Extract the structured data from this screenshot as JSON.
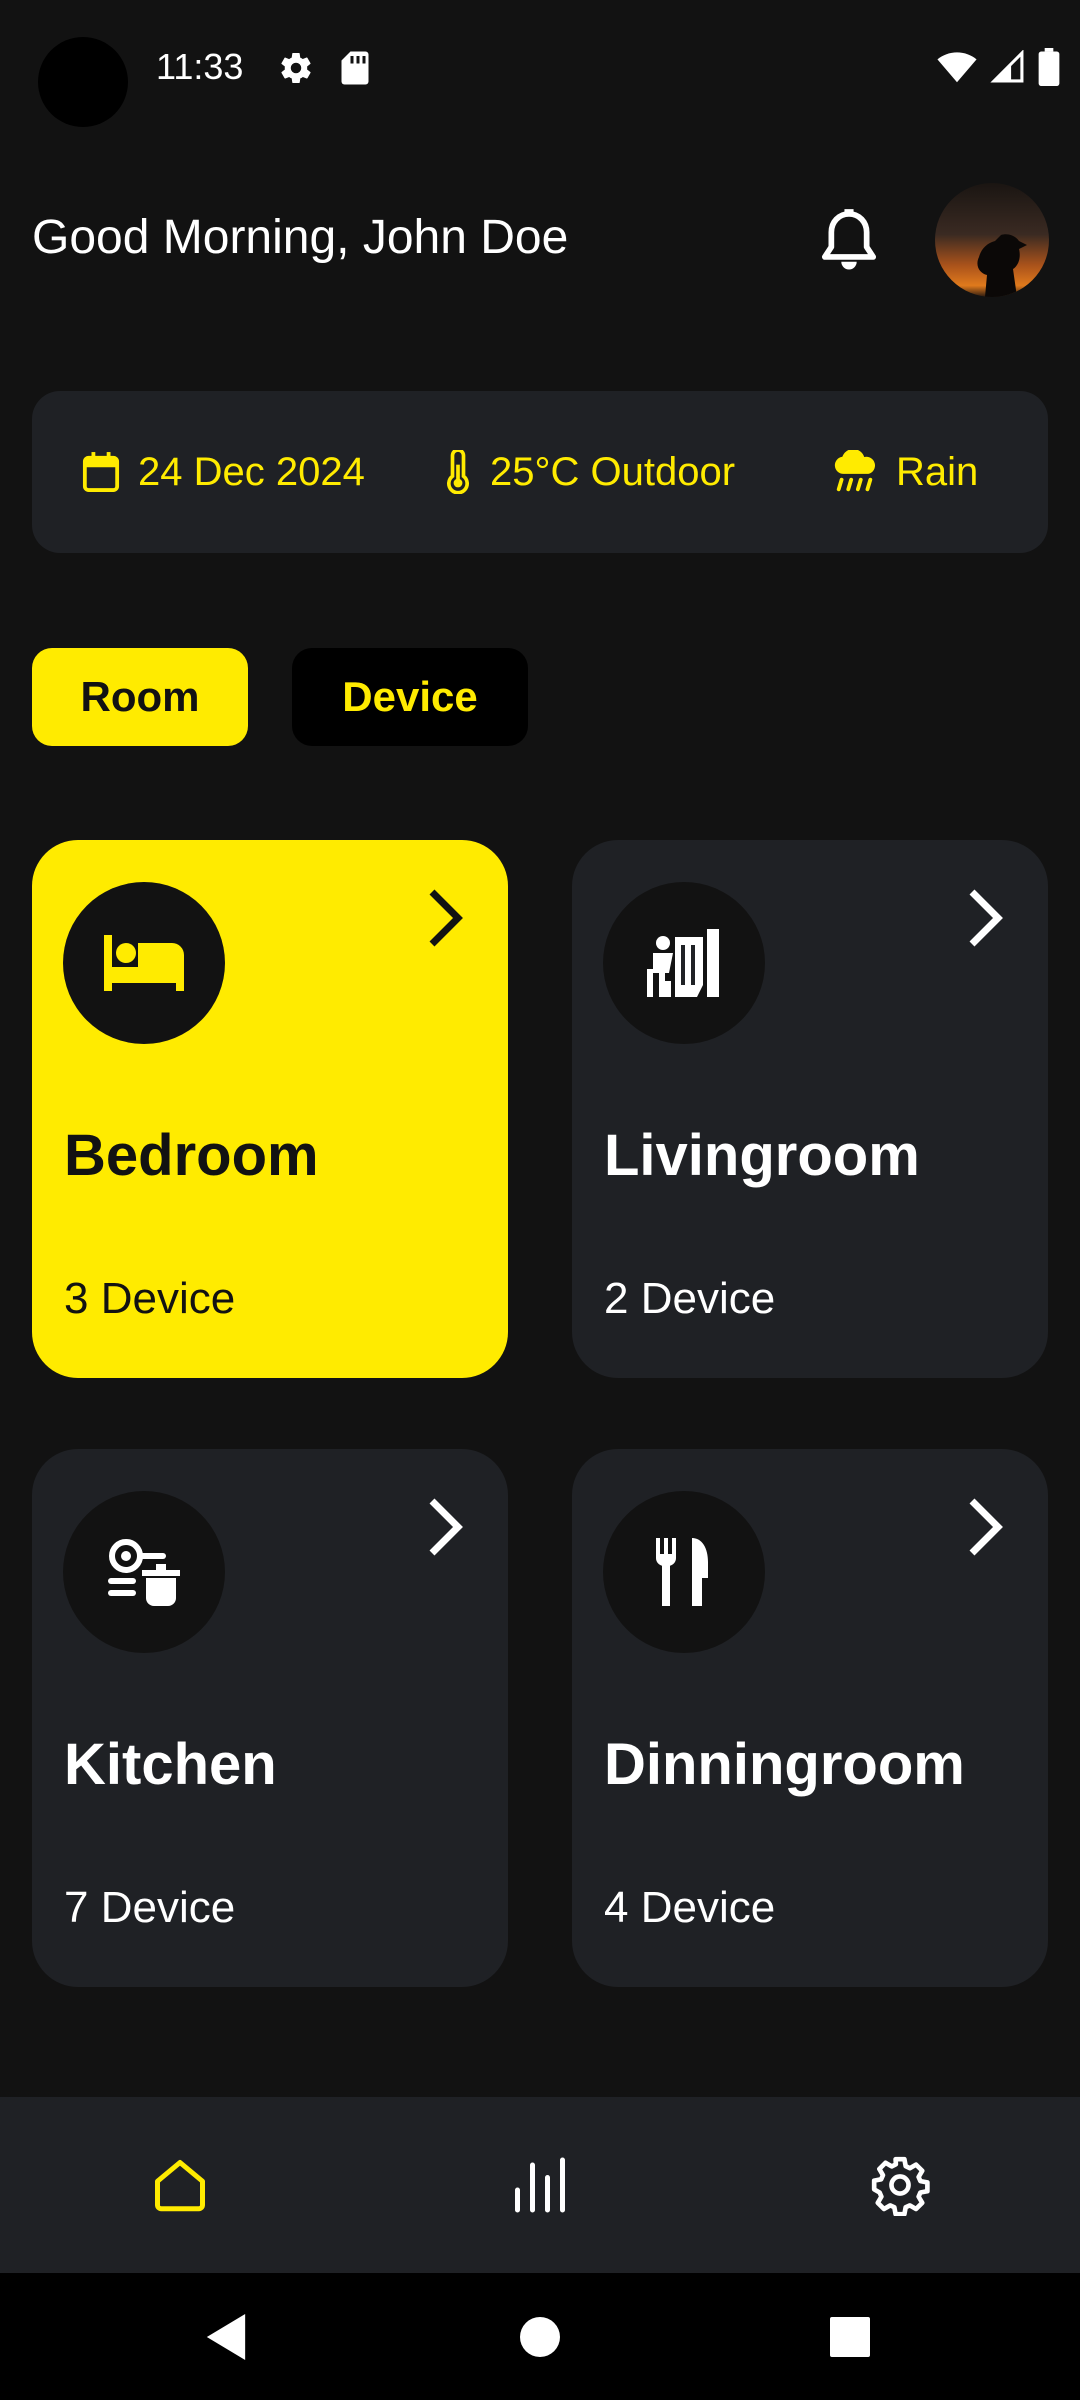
{
  "status_bar": {
    "time": "11:33"
  },
  "header": {
    "greeting": "Good Morning, John Doe"
  },
  "info": {
    "date": "24 Dec 2024",
    "temperature": "25°C Outdoor",
    "weather": "Rain"
  },
  "tabs": [
    {
      "label": "Room",
      "selected": true
    },
    {
      "label": "Device",
      "selected": false
    }
  ],
  "rooms": [
    {
      "name": "Bedroom",
      "devices": "3 Device",
      "icon": "bed-icon",
      "active": true
    },
    {
      "name": "Livingroom",
      "devices": "2 Device",
      "icon": "living-room-icon",
      "active": false
    },
    {
      "name": "Kitchen",
      "devices": "7 Device",
      "icon": "kitchen-icon",
      "active": false
    },
    {
      "name": "Dinningroom",
      "devices": "4 Device",
      "icon": "dining-icon",
      "active": false
    }
  ],
  "bottom_nav": [
    {
      "icon": "home-icon",
      "active": true
    },
    {
      "icon": "stats-icon",
      "active": false
    },
    {
      "icon": "settings-icon",
      "active": false
    }
  ],
  "colors": {
    "accent": "#ffeb00",
    "background": "#121212",
    "card": "#1f2125",
    "text": "#ffffff"
  }
}
